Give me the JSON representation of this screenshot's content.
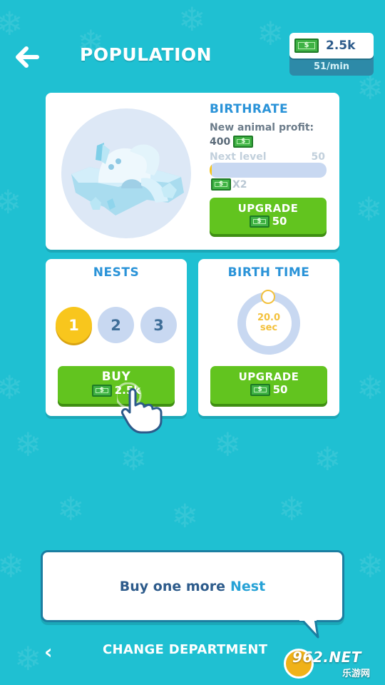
{
  "header": {
    "title": "POPULATION",
    "currency": {
      "amount": "2.5k",
      "rate": "51/min",
      "icon": "cash-icon"
    }
  },
  "birthrate": {
    "heading": "BIRTHRATE",
    "profit_label": "New animal profit:",
    "profit_value": "400",
    "next_level_label": "Next level",
    "next_level_value": "50",
    "progress_fraction": 0.02,
    "multiplier": "X2",
    "upgrade_label": "UPGRADE",
    "upgrade_price": "50"
  },
  "nests": {
    "heading": "NESTS",
    "levels": [
      "1",
      "2",
      "3"
    ],
    "owned": 1,
    "buy_label": "BUY",
    "buy_price": "2.5k"
  },
  "birth_time": {
    "heading": "BIRTH TIME",
    "timer_value": "20.0",
    "timer_unit": "sec",
    "upgrade_label": "UPGRADE",
    "upgrade_price": "50"
  },
  "hint": {
    "text": "Buy one more",
    "highlight": "Nest"
  },
  "footer": {
    "label": "CHANGE DEPARTMENT"
  },
  "watermark": {
    "text": "962.NET",
    "sub": "乐游网"
  },
  "colors": {
    "background": "#1fc0d2",
    "heading_blue": "#2a93d8",
    "button_green": "#62c41f",
    "coin_yellow": "#f8c61d",
    "inactive_circle": "#c8d8f1"
  }
}
